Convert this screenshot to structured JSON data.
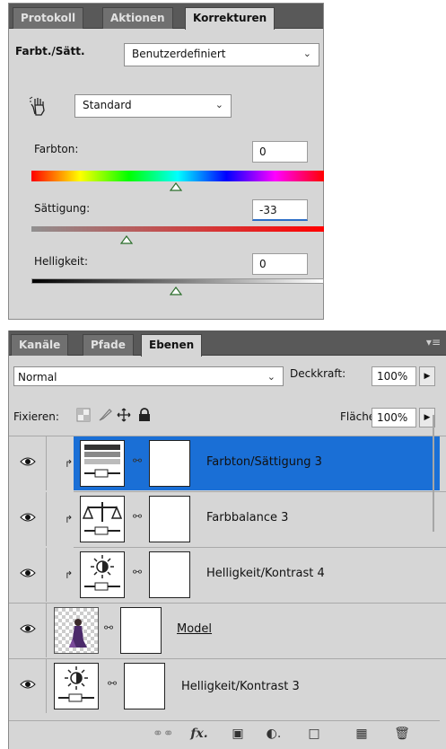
{
  "adjust_panel": {
    "tabs": [
      "Protokoll",
      "Aktionen",
      "Korrekturen"
    ],
    "active_tab": "Korrekturen",
    "title": "Farbt./Sätt.",
    "preset": "Benutzerdefiniert",
    "channel": "Standard",
    "hue": {
      "label": "Farbton:",
      "value": "0"
    },
    "saturation": {
      "label": "Sättigung:",
      "value": "-33"
    },
    "lightness": {
      "label": "Helligkeit:",
      "value": "0"
    }
  },
  "layers_panel": {
    "tabs": [
      "Kanäle",
      "Pfade",
      "Ebenen"
    ],
    "active_tab": "Ebenen",
    "blend_mode": "Normal",
    "opacity_label": "Deckkraft:",
    "opacity": "100%",
    "lock_label": "Fixieren:",
    "fill_label": "Fläche:",
    "fill": "100%",
    "layers": [
      {
        "name": "Farbton/Sättigung 3",
        "icon": "hue-saturation-icon",
        "selected": true
      },
      {
        "name": "Farbbalance 3",
        "icon": "color-balance-icon",
        "selected": false
      },
      {
        "name": "Helligkeit/Kontrast 4",
        "icon": "brightness-icon",
        "selected": false
      },
      {
        "name": "Model",
        "icon": "image-thumbnail",
        "selected": false
      },
      {
        "name": "Helligkeit/Kontrast 3",
        "icon": "brightness-icon",
        "selected": false
      }
    ],
    "bottom_icons": [
      "link-icon",
      "fx-icon",
      "mask-icon",
      "adjustment-icon",
      "folder-icon",
      "new-layer-icon",
      "trash-icon"
    ]
  }
}
